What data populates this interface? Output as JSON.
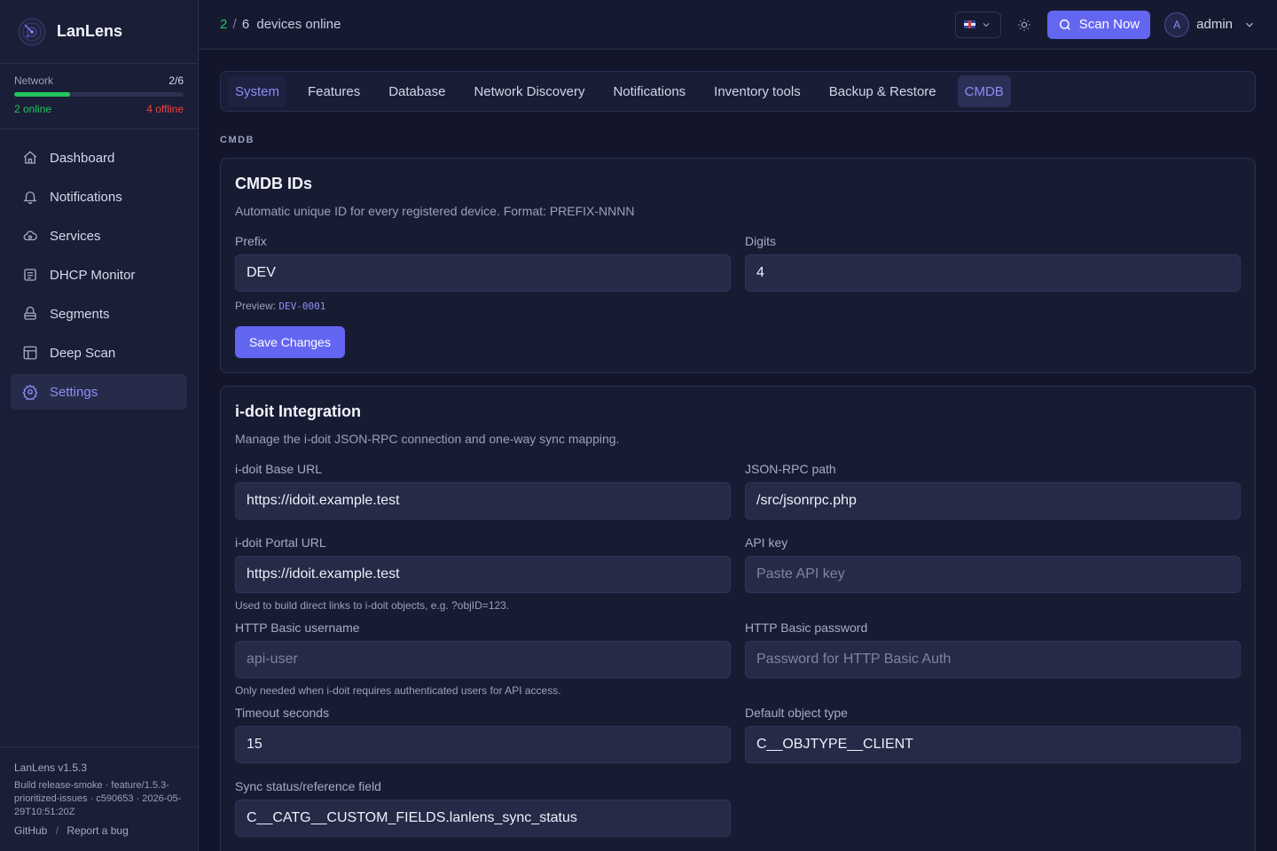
{
  "app": {
    "name": "LanLens",
    "version": "LanLens v1.5.3",
    "build": "Build release-smoke · feature/1.5.3-prioritized-issues · c590653 · 2026-05-29T10:51:20Z",
    "links": [
      "GitHub",
      "Report a bug"
    ]
  },
  "network": {
    "label": "Network",
    "count": "2/6",
    "online": "2 online",
    "offline": "4 offline",
    "online_fraction": 0.33
  },
  "sidebar": {
    "items": [
      {
        "label": "Dashboard",
        "icon": "home-icon"
      },
      {
        "label": "Notifications",
        "icon": "bell-icon"
      },
      {
        "label": "Services",
        "icon": "services-icon"
      },
      {
        "label": "DHCP Monitor",
        "icon": "dhcp-icon"
      },
      {
        "label": "Segments",
        "icon": "segments-icon"
      },
      {
        "label": "Deep Scan",
        "icon": "deep-scan-icon"
      },
      {
        "label": "Settings",
        "icon": "gear-icon",
        "active": true
      }
    ]
  },
  "topbar": {
    "online": "2",
    "sep": "/",
    "total": "6",
    "status_text": "devices online",
    "scan_label": "Scan Now",
    "user": "admin",
    "avatar_initial": "A"
  },
  "tabs": [
    "System",
    "Features",
    "Database",
    "Network Discovery",
    "Notifications",
    "Inventory tools",
    "Backup & Restore",
    "CMDB"
  ],
  "active_tab": "CMDB",
  "section_label": "CMDB",
  "cmdb_ids": {
    "title": "CMDB IDs",
    "desc": "Automatic unique ID for every registered device. Format: PREFIX-NNNN",
    "prefix_label": "Prefix",
    "prefix_value": "DEV",
    "digits_label": "Digits",
    "digits_value": "4",
    "preview_label": "Preview:",
    "preview_value": "DEV-0001",
    "save_label": "Save Changes"
  },
  "idoit": {
    "title": "i-doit Integration",
    "desc": "Manage the i-doit JSON-RPC connection and one-way sync mapping.",
    "base_url_label": "i-doit Base URL",
    "base_url_value": "https://idoit.example.test",
    "rpc_path_label": "JSON-RPC path",
    "rpc_path_value": "/src/jsonrpc.php",
    "portal_url_label": "i-doit Portal URL",
    "portal_url_value": "https://idoit.example.test",
    "portal_hint": "Used to build direct links to i-doit objects, e.g. ?objID=123.",
    "api_key_label": "API key",
    "api_key_placeholder": "Paste API key",
    "http_user_label": "HTTP Basic username",
    "http_user_placeholder": "api-user",
    "http_user_hint": "Only needed when i-doit requires authenticated users for API access.",
    "http_pass_label": "HTTP Basic password",
    "http_pass_placeholder": "Password for HTTP Basic Auth",
    "timeout_label": "Timeout seconds",
    "timeout_value": "15",
    "obj_type_label": "Default object type",
    "obj_type_value": "C__OBJTYPE__CLIENT",
    "sync_field_label": "Sync status/reference field",
    "sync_field_value": "C__CATG__CUSTOM_FIELDS.lanlens_sync_status"
  },
  "colors": {
    "accent": "#6366f1",
    "online": "#22c55e",
    "offline": "#ef4444",
    "bg": "#13162a"
  }
}
